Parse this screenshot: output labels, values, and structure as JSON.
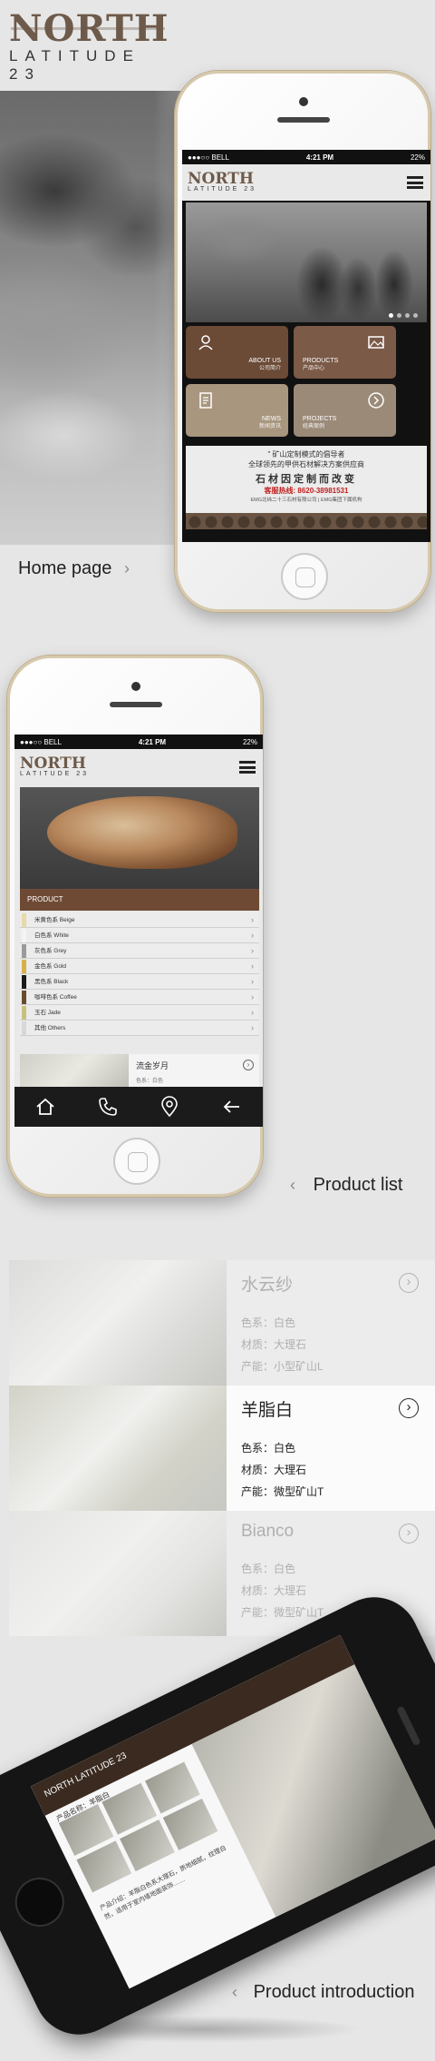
{
  "brand": {
    "name": "NORTH",
    "tagline": "LATITUDE 23"
  },
  "captions": {
    "home": "Home page",
    "list": "Product list",
    "intro": "Product introduction",
    "chevron_right": "›",
    "chevron_left": "‹"
  },
  "status": {
    "carrier": "●●●○○ BELL",
    "time": "4:21 PM",
    "battery": "22%"
  },
  "home_screen": {
    "tiles": [
      {
        "label": "ABOUT US",
        "sub": "公司简介",
        "icon": "user-icon",
        "color": "#6b4a36"
      },
      {
        "label": "PRODUCTS",
        "sub": "产品中心",
        "icon": "image-icon",
        "color": "#7b5a48"
      },
      {
        "label": "NEWS",
        "sub": "新闻资讯",
        "icon": "document-icon",
        "color": "#a8967f"
      },
      {
        "label": "PROJECTS",
        "sub": "经典案例",
        "icon": "arrow-circle-icon",
        "color": "#9b8a78"
      }
    ],
    "slogan": {
      "line1": "\" 矿山定制模式的倡导者",
      "line2": "全球领先的甲供石材解决方案供应商",
      "line3": "石材因定制而改变",
      "line4": "客服热线: 8620-38981531",
      "line5": "EMG北纬二十三石材有限公司 | EMG集团下属机构"
    }
  },
  "list_screen": {
    "section_label": "PRODUCT",
    "rows": [
      {
        "label": "米黄色系  Beige",
        "color": "#e8d9a8"
      },
      {
        "label": "白色系  White",
        "color": "#f4f4f4"
      },
      {
        "label": "灰色系  Grey",
        "color": "#9a9a9a"
      },
      {
        "label": "金色系  Gold",
        "color": "#d8b04a"
      },
      {
        "label": "黑色系  Black",
        "color": "#1a1a1a"
      },
      {
        "label": "咖啡色系  Coffee",
        "color": "#6b4a30"
      },
      {
        "label": "玉石  Jade",
        "color": "#c9c080"
      },
      {
        "label": "其他  Others",
        "color": "#d8d8d8"
      }
    ],
    "teaser": {
      "name": "流金岁月",
      "sub": "色系：白色"
    }
  },
  "materials": [
    {
      "name": "水云纱",
      "color_line": "色系：白色",
      "material_line": "材质：大理石",
      "origin_line": "产能：小型矿山L",
      "state": "dim",
      "swatch": "#dcdcda"
    },
    {
      "name": "羊脂白",
      "color_line": "色系：白色",
      "material_line": "材质：大理石",
      "origin_line": "产能：微型矿山T",
      "state": "active",
      "swatch": "#d2d2c8"
    },
    {
      "name": "Bianco",
      "color_line": "色系：白色",
      "material_line": "材质：大理石",
      "origin_line": "产能：微型矿山T",
      "state": "dim",
      "swatch": "#e4e4e2"
    }
  ],
  "intro_screen": {
    "header": "NORTH LATITUDE 23",
    "subtitle": "产品名称：羊脂白",
    "body": "产品介绍：羊脂白色系大理石，质地细腻，纹理自然，适用于室内墙地面装饰……"
  }
}
